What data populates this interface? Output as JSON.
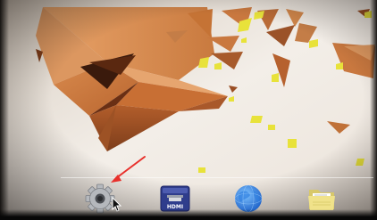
{
  "screen": {
    "wallpaper_name": "origami-polygon-wallpaper",
    "colors": {
      "background": "#f1ece6",
      "origami_orange": "#c9783f",
      "origami_dark": "#8a4621",
      "confetti_yellow": "#e8e23a",
      "annotation_arrow": "#e8302b"
    }
  },
  "dock": {
    "items": [
      {
        "name": "settings",
        "icon": "gear-icon"
      },
      {
        "name": "hdmi-input",
        "icon": "hdmi-icon",
        "label": "HDMI"
      },
      {
        "name": "browser",
        "icon": "globe-icon"
      },
      {
        "name": "file-manager",
        "icon": "folder-icon"
      }
    ]
  },
  "annotation": {
    "type": "arrow",
    "points_to": "settings"
  },
  "pointer": {
    "icon": "mouse-cursor-icon"
  }
}
